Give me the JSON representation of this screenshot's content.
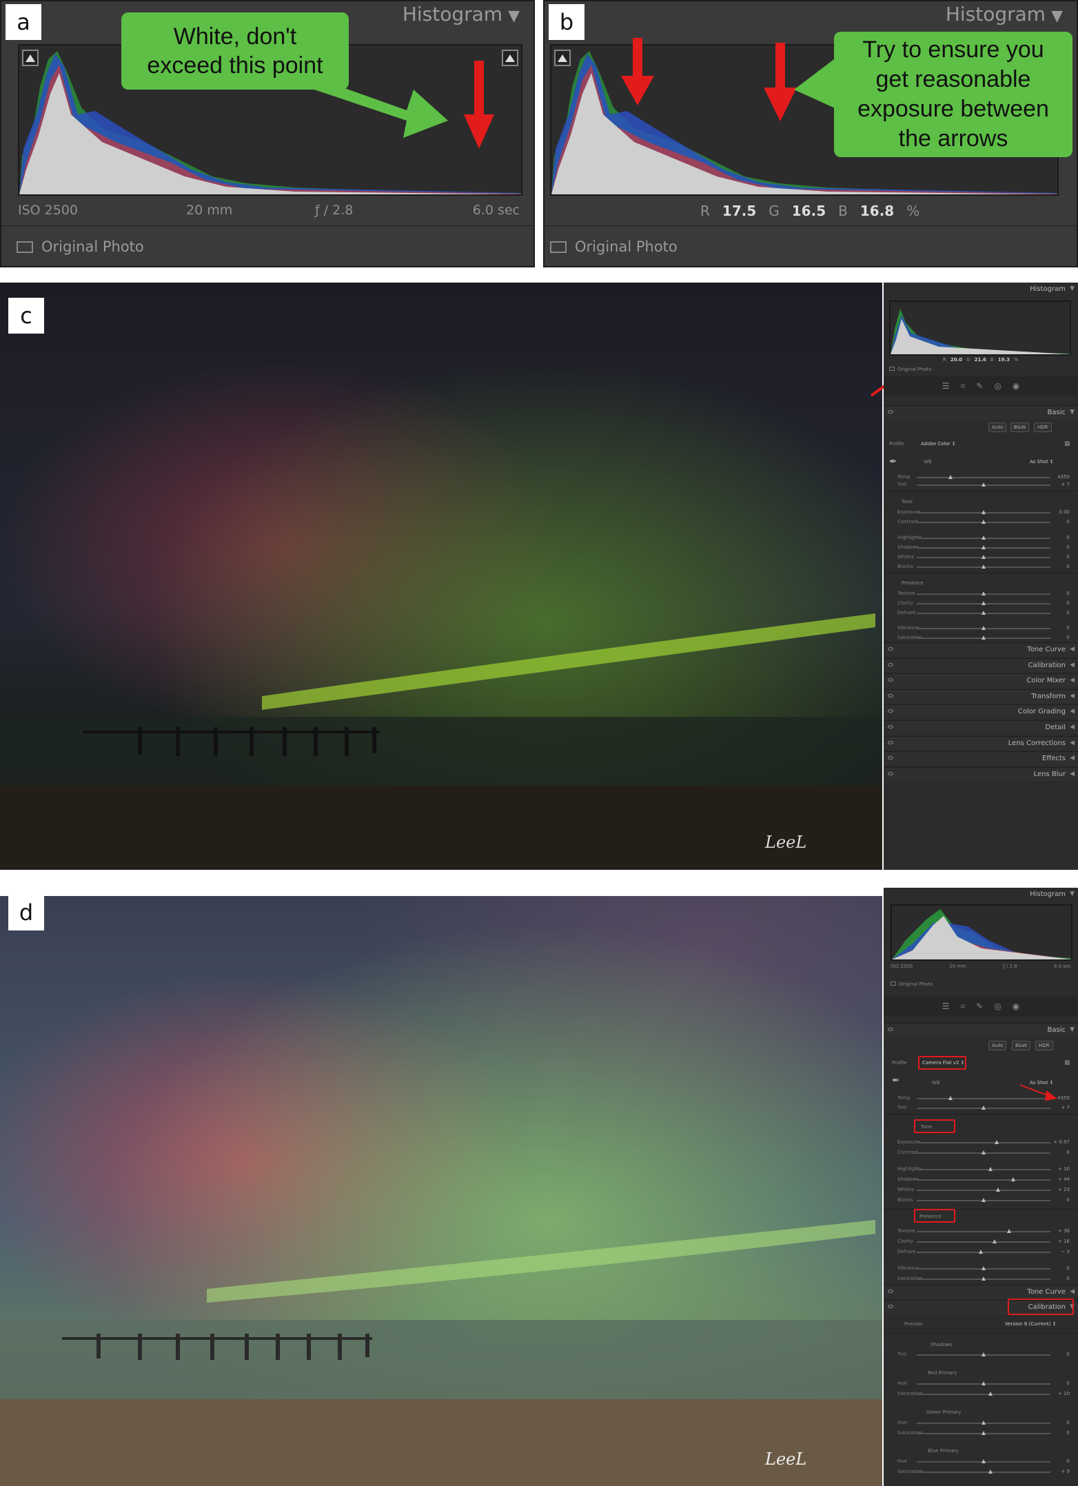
{
  "panel_labels": {
    "a": "a",
    "b": "b",
    "c": "c",
    "d": "d"
  },
  "panel_a": {
    "histogram_title": "Histogram",
    "iso": "ISO 2500",
    "focal": "20 mm",
    "aperture": "ƒ / 2.8",
    "shutter": "6.0 sec",
    "original_photo": "Original Photo",
    "callout_line1": "White, don't",
    "callout_line2": "exceed this point"
  },
  "panel_b": {
    "histogram_title": "Histogram",
    "r_label": "R",
    "r_value": "17.5",
    "g_label": "G",
    "g_value": "16.5",
    "b_label": "B",
    "b_value": "16.8",
    "pct": "%",
    "original_photo": "Original Photo",
    "callout_lines": [
      "Try to ensure you",
      "get reasonable",
      "exposure between",
      "the arrows"
    ]
  },
  "panel_c": {
    "histogram_title": "Histogram",
    "r_label": "R",
    "r_value": "20.0",
    "g_label": "G",
    "g_value": "21.6",
    "b_label": "B",
    "b_value": "19.3",
    "pct": "%",
    "original_photo": "Original Photo",
    "basic": "Basic",
    "btn_auto": "Auto",
    "btn_bw": "B&W",
    "btn_hdr": "HDR",
    "profile_label": "Profile",
    "profile_value": "Adobe Color ↕",
    "wb_label": "WB",
    "wb_value": "As Shot ↕",
    "temp": {
      "label": "Temp",
      "value": "4350",
      "pos": 0.25
    },
    "tint": {
      "label": "Tint",
      "value": "+ 7",
      "pos": 0.5
    },
    "tone_label": "Tone",
    "tone": [
      {
        "label": "Exposure",
        "value": "0.00",
        "pos": 0.5
      },
      {
        "label": "Contrast",
        "value": "0",
        "pos": 0.5
      }
    ],
    "tone2": [
      {
        "label": "Highlights",
        "value": "0",
        "pos": 0.5
      },
      {
        "label": "Shadows",
        "value": "0",
        "pos": 0.5
      },
      {
        "label": "Whites",
        "value": "0",
        "pos": 0.5
      },
      {
        "label": "Blacks",
        "value": "0",
        "pos": 0.5
      }
    ],
    "presence_label": "Presence",
    "presence": [
      {
        "label": "Texture",
        "value": "0",
        "pos": 0.5
      },
      {
        "label": "Clarity",
        "value": "0",
        "pos": 0.5
      },
      {
        "label": "Dehaze",
        "value": "0",
        "pos": 0.5
      }
    ],
    "presence2": [
      {
        "label": "Vibrance",
        "value": "0",
        "pos": 0.5
      },
      {
        "label": "Saturation",
        "value": "0",
        "pos": 0.5
      }
    ],
    "sections": [
      "Tone Curve",
      "Calibration",
      "Color Mixer",
      "Transform",
      "Color Grading",
      "Detail",
      "Lens Corrections",
      "Effects",
      "Lens Blur"
    ]
  },
  "panel_d": {
    "histogram_title": "Histogram",
    "iso": "ISO 2500",
    "focal": "20 mm",
    "aperture": "ƒ / 2.8",
    "shutter": "6.0 sec",
    "original_photo": "Original Photo",
    "basic": "Basic",
    "btn_auto": "Auto",
    "btn_bw": "B&W",
    "btn_hdr": "HDR",
    "profile_label": "Profile",
    "profile_value": "Camera Flat v2 ↕",
    "wb_label": "WB",
    "wb_value": "As Shot ↕",
    "temp": {
      "label": "Temp",
      "value": "4350",
      "pos": 0.25
    },
    "tint": {
      "label": "Tint",
      "value": "+ 7",
      "pos": 0.5
    },
    "tone_label": "Tone",
    "tone": [
      {
        "label": "Exposure",
        "value": "+ 0.97",
        "pos": 0.6
      },
      {
        "label": "Contrast",
        "value": "0",
        "pos": 0.5
      }
    ],
    "tone2": [
      {
        "label": "Highlights",
        "value": "+ 10",
        "pos": 0.55
      },
      {
        "label": "Shadows",
        "value": "+ 44",
        "pos": 0.72
      },
      {
        "label": "Whites",
        "value": "+ 23",
        "pos": 0.61
      },
      {
        "label": "Blacks",
        "value": "0",
        "pos": 0.5
      }
    ],
    "presence_label": "Presence",
    "presence": [
      {
        "label": "Texture",
        "value": "+ 38",
        "pos": 0.69
      },
      {
        "label": "Clarity",
        "value": "+ 16",
        "pos": 0.58
      },
      {
        "label": "Dehaze",
        "value": "− 3",
        "pos": 0.48
      }
    ],
    "presence2": [
      {
        "label": "Vibrance",
        "value": "0",
        "pos": 0.5
      },
      {
        "label": "Saturation",
        "value": "0",
        "pos": 0.5
      }
    ],
    "tone_curve": "Tone Curve",
    "calibration": "Calibration",
    "process_label": "Process",
    "process_value": "Version 6 (Current) ↕",
    "cal_shadows": "Shadows",
    "cal_shadows_tint": {
      "label": "Tint",
      "value": "0",
      "pos": 0.5
    },
    "red_primary": "Red Primary",
    "red_hue": {
      "label": "Hue",
      "value": "0",
      "pos": 0.5
    },
    "red_sat": {
      "label": "Saturation",
      "value": "+ 10",
      "pos": 0.55
    },
    "green_primary": "Green Primary",
    "green_hue": {
      "label": "Hue",
      "value": "0",
      "pos": 0.5
    },
    "green_sat": {
      "label": "Saturation",
      "value": "0",
      "pos": 0.5
    },
    "blue_primary": "Blue Primary",
    "blue_hue": {
      "label": "Hue",
      "value": "0",
      "pos": 0.5
    },
    "blue_sat": {
      "label": "Saturation",
      "value": "+ 9",
      "pos": 0.55
    }
  },
  "colors": {
    "callout_green": "#5dbf45",
    "arrow_red": "#e21b1b",
    "panel_bg": "#2c2c2c"
  }
}
